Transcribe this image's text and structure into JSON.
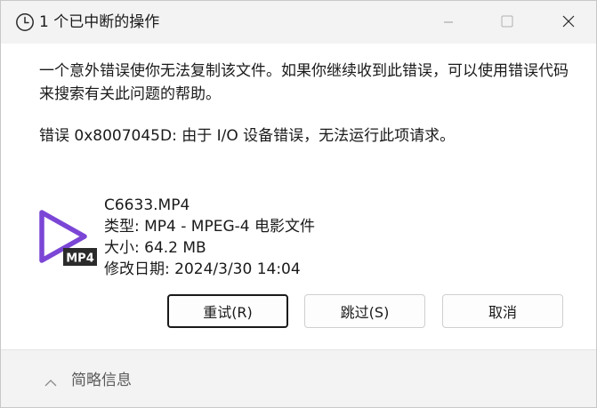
{
  "window": {
    "title": "1 个已中断的操作",
    "icon": "clock-icon"
  },
  "message": {
    "text": "一个意外错误使你无法复制该文件。如果你继续收到此错误，可以使用错误代码来搜索有关此问题的帮助。",
    "error": "错误 0x8007045D: 由于 I/O 设备错误，无法运行此项请求。"
  },
  "file": {
    "name": "C6633.MP4",
    "type": "类型: MP4 - MPEG-4 电影文件",
    "size": "大小: 64.2 MB",
    "modified": "修改日期: 2024/3/30 14:04",
    "icon_badge": "MP4",
    "accent_color": "#7b46d6"
  },
  "buttons": {
    "retry": "重试(R)",
    "skip": "跳过(S)",
    "cancel": "取消"
  },
  "footer": {
    "details": "简略信息"
  }
}
